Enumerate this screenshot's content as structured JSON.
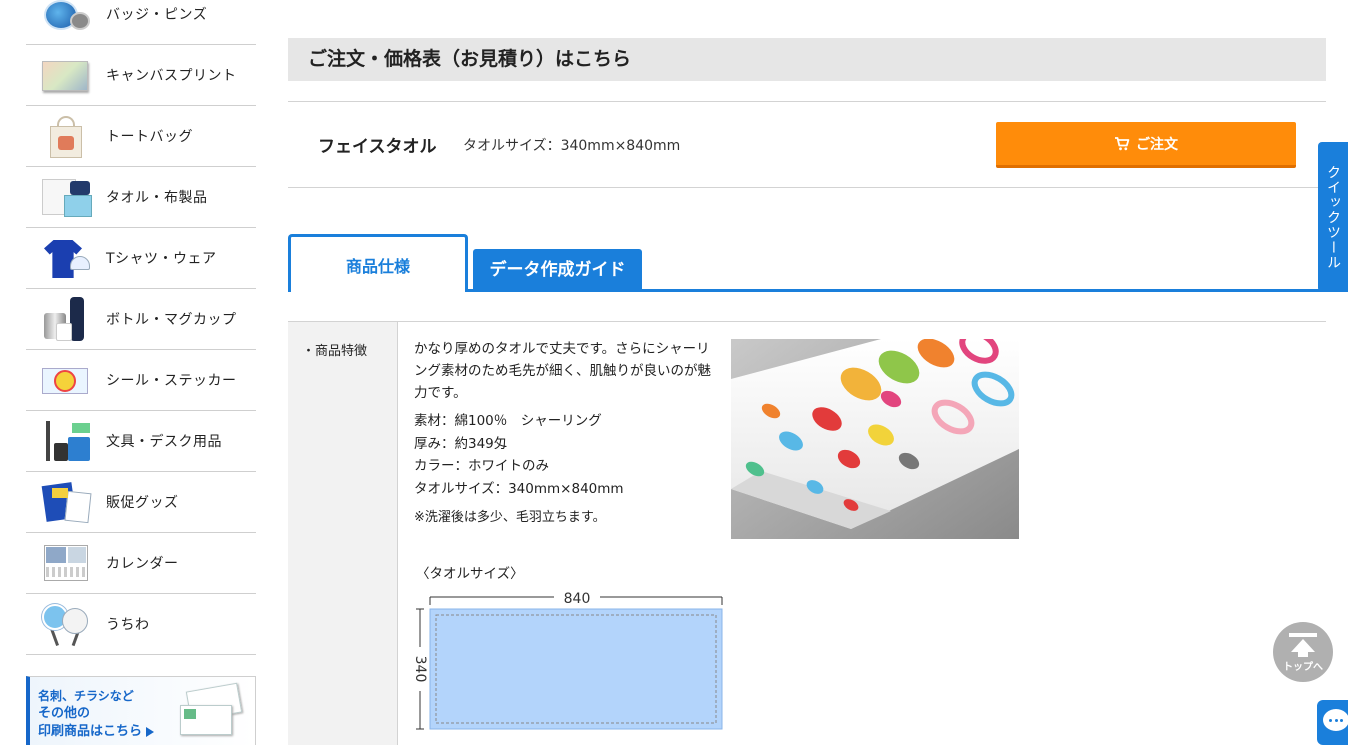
{
  "sidebar": {
    "items": [
      {
        "label": "バッジ・ピンズ",
        "icon": "badge-thumbnail"
      },
      {
        "label": "キャンバスプリント",
        "icon": "canvas-thumbnail"
      },
      {
        "label": "トートバッグ",
        "icon": "tote-thumbnail"
      },
      {
        "label": "タオル・布製品",
        "icon": "towel-thumbnail"
      },
      {
        "label": "Tシャツ・ウェア",
        "icon": "tshirt-thumbnail"
      },
      {
        "label": "ボトル・マグカップ",
        "icon": "bottle-thumbnail"
      },
      {
        "label": "シール・ステッカー",
        "icon": "sticker-thumbnail"
      },
      {
        "label": "文具・デスク用品",
        "icon": "stationery-thumbnail"
      },
      {
        "label": "販促グッズ",
        "icon": "promo-thumbnail"
      },
      {
        "label": "カレンダー",
        "icon": "calendar-thumbnail"
      },
      {
        "label": "うちわ",
        "icon": "fan-thumbnail"
      }
    ],
    "banner": {
      "line1": "名刺、チラシなど",
      "line2": "その他の",
      "line3": "印刷商品はこちら"
    }
  },
  "main": {
    "order_heading": "ご注文・価格表（お見積り）はこちら",
    "product": {
      "name": "フェイスタオル",
      "size": "タオルサイズ：340mm×840mm",
      "order_button": "ご注文"
    },
    "tabs": {
      "active": "商品仕様",
      "inactive": "データ作成ガイド"
    },
    "spec": {
      "label": "・商品特徴",
      "description": "かなり厚めのタオルで丈夫です。さらにシャーリング素材のため毛先が細く、肌触りが良いのが魅力です。",
      "material": "素材：綿100％　シャーリング",
      "thickness": "厚み：約349匁",
      "color": "カラー：ホワイトのみ",
      "size": "タオルサイズ：340mm×840mm",
      "note": "※洗濯後は多少、毛羽立ちます。",
      "diagram_caption": "〈タオルサイズ〉",
      "diagram_width": "840",
      "diagram_height": "340"
    }
  },
  "widgets": {
    "quick_tool": "クイックツール",
    "to_top": "トップへ"
  },
  "colors": {
    "accent_blue": "#1a7fdb",
    "order_orange": "#ff8c0a",
    "heading_gray": "#e6e6e6",
    "diagram_fill": "#b3d4fb"
  }
}
